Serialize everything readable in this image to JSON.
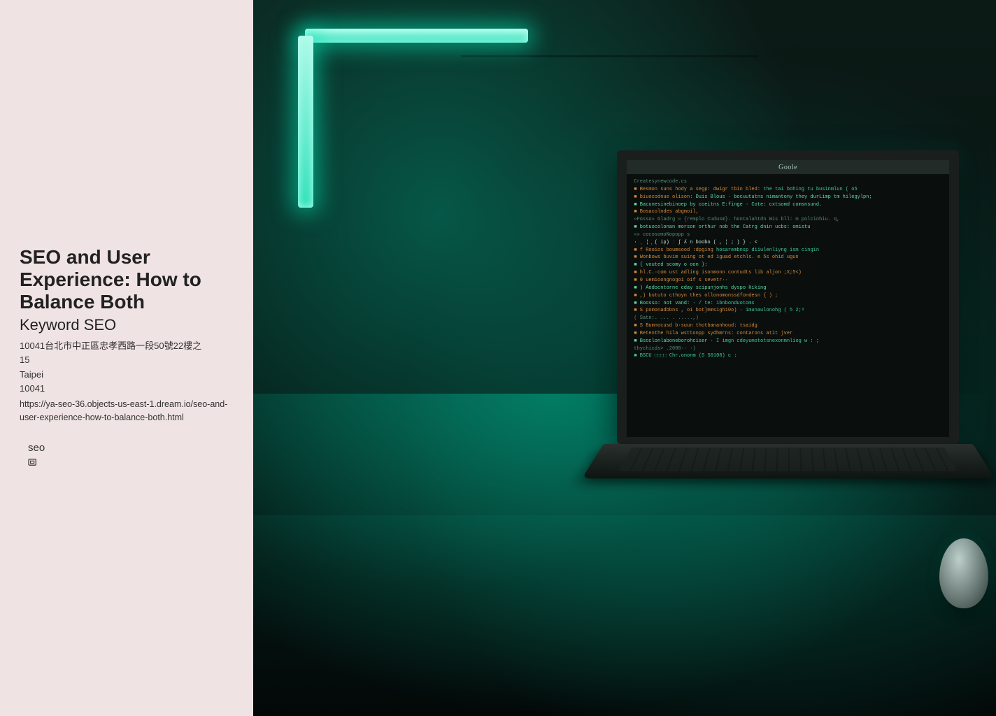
{
  "article": {
    "title": "SEO and User Experience: How to Balance Both",
    "subtitle": "Keyword SEO",
    "address_line": "10041台北市中正區忠孝西路一段50號22樓之",
    "address_num": "15",
    "city": "Taipei",
    "postal": "10041",
    "url": "https://ya-seo-36.objects-us-east-1.dream.io/seo-and-user-experience-how-to-balance-both.html",
    "tag": "seo"
  },
  "hero": {
    "browser_title": "Goole"
  }
}
